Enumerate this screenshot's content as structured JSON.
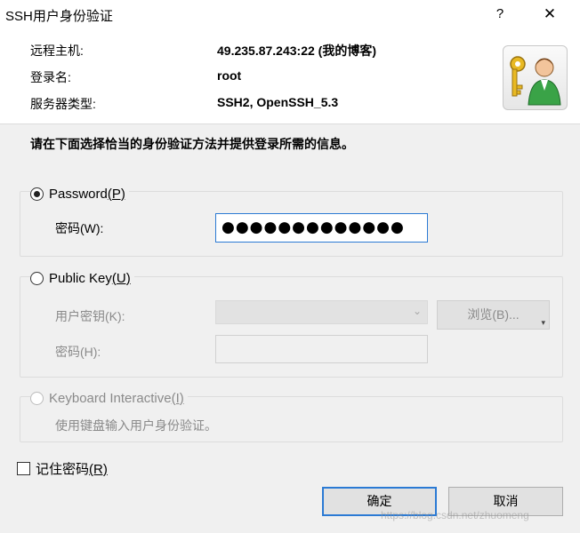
{
  "window": {
    "title": "SSH用户身份验证",
    "help_glyph": "?",
    "close_glyph": "✕"
  },
  "info": {
    "host_label": "远程主机:",
    "host_value": "49.235.87.243:22 (我的博客)",
    "login_label": "登录名:",
    "login_value": "root",
    "server_type_label": "服务器类型:",
    "server_type_value": "SSH2, OpenSSH_5.3",
    "icon": "key-user-icon"
  },
  "instruction": "请在下面选择恰当的身份验证方法并提供登录所需的信息。",
  "password_group": {
    "radio_label": "Password",
    "radio_mnemonic": "(P)",
    "checked": true,
    "field_label": "密码",
    "field_mnemonic": "(W):",
    "field_value": "●●●●●●●●●●●●●"
  },
  "publickey_group": {
    "radio_label": "Public Key",
    "radio_mnemonic": "(U)",
    "checked": false,
    "key_label": "用户密钥",
    "key_mnemonic": "(K):",
    "key_value": "",
    "browse_label": "浏览",
    "browse_mnemonic": "(B)...",
    "pw_label": "密码",
    "pw_mnemonic": "(H):",
    "pw_value": ""
  },
  "keyboard_group": {
    "radio_label": "Keyboard Interactive",
    "radio_mnemonic": "(I)",
    "description": "使用键盘输入用户身份验证。"
  },
  "remember": {
    "label": "记住密码",
    "mnemonic": "(R)",
    "checked": false
  },
  "buttons": {
    "ok": "确定",
    "cancel": "取消"
  },
  "watermark": "https://blog.csdn.net/zhuomeng",
  "colors": {
    "accent": "#2b7ad4",
    "dialog_bg": "#f0f0f0",
    "disabled_text": "#8a8a8a"
  }
}
